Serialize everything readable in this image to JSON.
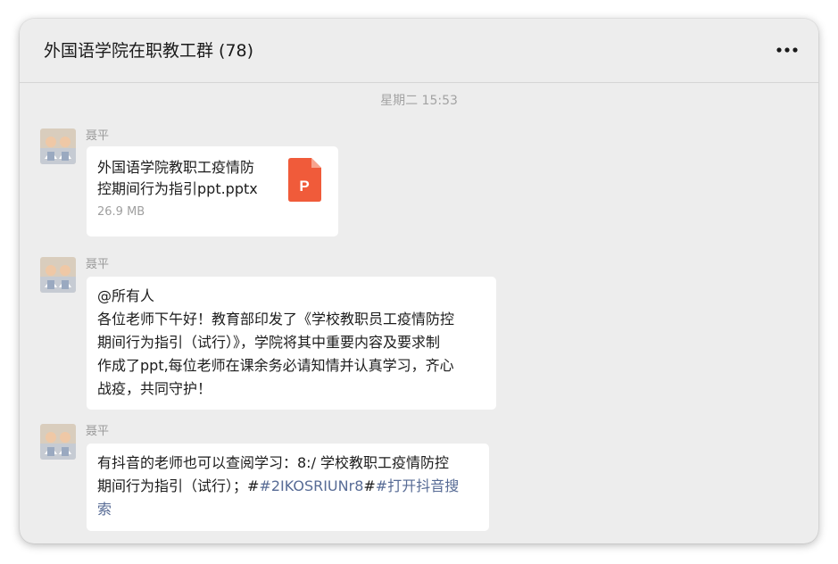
{
  "window": {
    "title": "外国语学院在职教工群 (78)",
    "more_icon": "more-dots-icon"
  },
  "timestamp": "星期二 15:53",
  "messages": [
    {
      "sender": "聂平",
      "type": "file",
      "file": {
        "name_line1": "外国语学院教职工疫情防",
        "name_line2": "控期间行为指引ppt.pptx",
        "size": "26.9 MB",
        "icon": "ppt-file-icon",
        "icon_letter": "P",
        "icon_color": "#f05b3a"
      }
    },
    {
      "sender": "聂平",
      "type": "text",
      "lines": [
        "@所有人",
        "各位老师下午好！教育部印发了《学校教职员工疫情防控",
        "期间行为指引（试行）》，学院将其中重要内容及要求制",
        "作成了ppt,每位老师在课余务必请知情并认真学习，齐心",
        "战疫，共同守护！"
      ]
    },
    {
      "sender": "聂平",
      "type": "text",
      "line1": "有抖音的老师也可以查阅学习：8:/ 学校教职工疫情防控",
      "line2_plain": "期间行为指引（试行）；#",
      "line2_link1": "#2IKOSRIUNr8",
      "line2_hash": "#",
      "line2_link2": "#打开抖音搜",
      "line3_link": "索"
    }
  ],
  "colors": {
    "background": "#ededed",
    "bubble": "#ffffff",
    "link": "#576b95",
    "ppt_icon": "#f05b3a"
  }
}
